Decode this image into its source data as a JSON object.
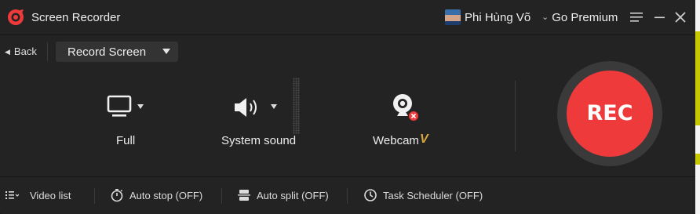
{
  "window": {
    "app_title": "Screen Recorder",
    "user_name": "Phi Hùng Võ",
    "premium_label": "Go Premium"
  },
  "toolbar": {
    "back_label": "Back",
    "mode_selected": "Record Screen"
  },
  "options": {
    "screen_label": "Full",
    "sound_label": "System sound",
    "webcam_label": "Webcam",
    "webcam_badge": "V"
  },
  "record_button_label": "REC",
  "footer": {
    "video_list": "Video list",
    "auto_stop": "Auto stop (OFF)",
    "auto_split": "Auto split (OFF)",
    "task_scheduler": "Task Scheduler (OFF)"
  },
  "icons": {
    "logo": "screen-recorder-logo-icon",
    "menu": "hamburger-menu-icon",
    "minimize": "minimize-icon",
    "close": "close-icon",
    "screen": "monitor-icon",
    "sound": "speaker-icon",
    "webcam": "webcam-icon",
    "webcam_status": "webcam-off-icon",
    "list": "list-icon",
    "stopwatch": "stopwatch-icon",
    "split": "split-icon",
    "clock": "clock-icon"
  },
  "colors": {
    "accent": "#ee3a3a",
    "background": "#232323",
    "vip": "#d9a741"
  }
}
